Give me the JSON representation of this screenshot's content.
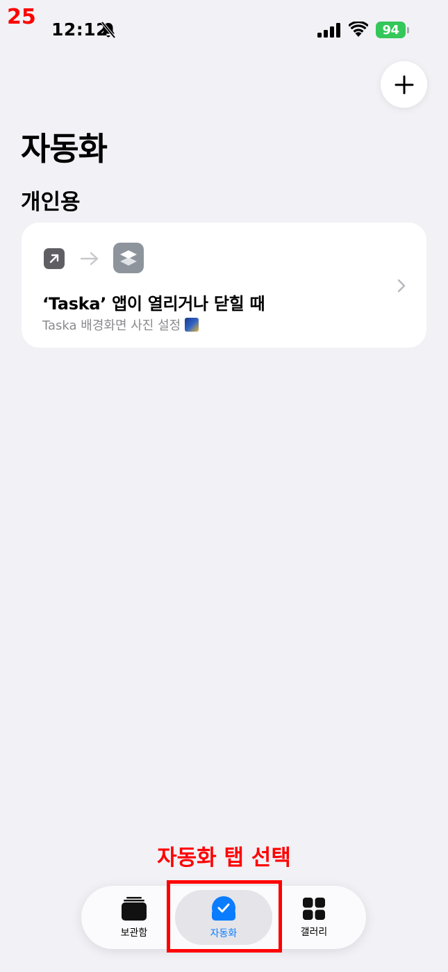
{
  "annotation": {
    "step_number": "25",
    "instruction": "자동화 탭 선택",
    "color": "#ff0000"
  },
  "status_bar": {
    "time": "12:12",
    "silent_icon": "bell-slash-icon",
    "battery_level": "94",
    "battery_color": "#34c759"
  },
  "header": {
    "add_icon": "plus-icon",
    "title": "자동화",
    "section": "개인용"
  },
  "automation_card": {
    "trigger_icon": "arrow-up-right-icon",
    "app_icon": "shortcuts-layers-icon",
    "title": "‘Taska’ 앱이 열리거나 닫힐 때",
    "subtitle": "Taska 배경화면 사진 설정"
  },
  "tab_bar": {
    "selected": "자동화",
    "accent_color": "#0a7cff",
    "tabs": [
      {
        "label": "보관함",
        "icon": "library-stack-icon"
      },
      {
        "label": "자동화",
        "icon": "automation-check-icon"
      },
      {
        "label": "갤러리",
        "icon": "gallery-grid-icon"
      }
    ]
  }
}
